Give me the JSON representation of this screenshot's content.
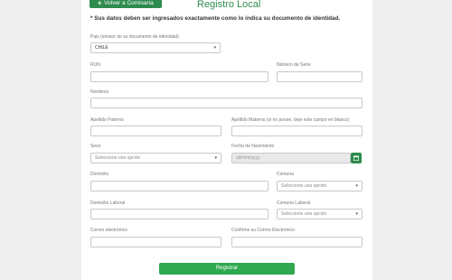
{
  "header": {
    "back_label": "Volver a Comisaria",
    "title": "Registro Local"
  },
  "notice": "* Sus datos deben ser ingresados exactamente como lo indica su documento de identidad.",
  "form": {
    "pais": {
      "label": "Pais (emisor de su documento de identidad)",
      "value": "CHILE"
    },
    "rut": {
      "label": "RUN"
    },
    "numero_serie": {
      "label": "Número de Serie"
    },
    "nombres": {
      "label": "Nombres"
    },
    "apellido_paterno": {
      "label": "Apellido Paterno"
    },
    "apellido_materno": {
      "label": "Apellido Materno (si no posee, deje este campo en blanco)"
    },
    "sexo": {
      "label": "Sexo",
      "placeholder": "Seleccione una opción"
    },
    "fecha_nacimiento": {
      "label": "Fecha de Nacimiento",
      "placeholder": "dd/mm/yyyy"
    },
    "domicilio": {
      "label": "Domicilio"
    },
    "comuna": {
      "label": "Comuna",
      "placeholder": "Seleccione una opción"
    },
    "domicilio_laboral": {
      "label": "Domicilio Laboral"
    },
    "comuna_laboral": {
      "label": "Comuna Laboral",
      "placeholder": "Seleccione una opción"
    },
    "correo": {
      "label": "Correo electrónico"
    },
    "confirme_correo": {
      "label": "Confirme su Correo Electrónico"
    },
    "submit_label": "Registrar"
  },
  "colors": {
    "accent": "#2e8b4e",
    "button": "#2fa84f"
  }
}
